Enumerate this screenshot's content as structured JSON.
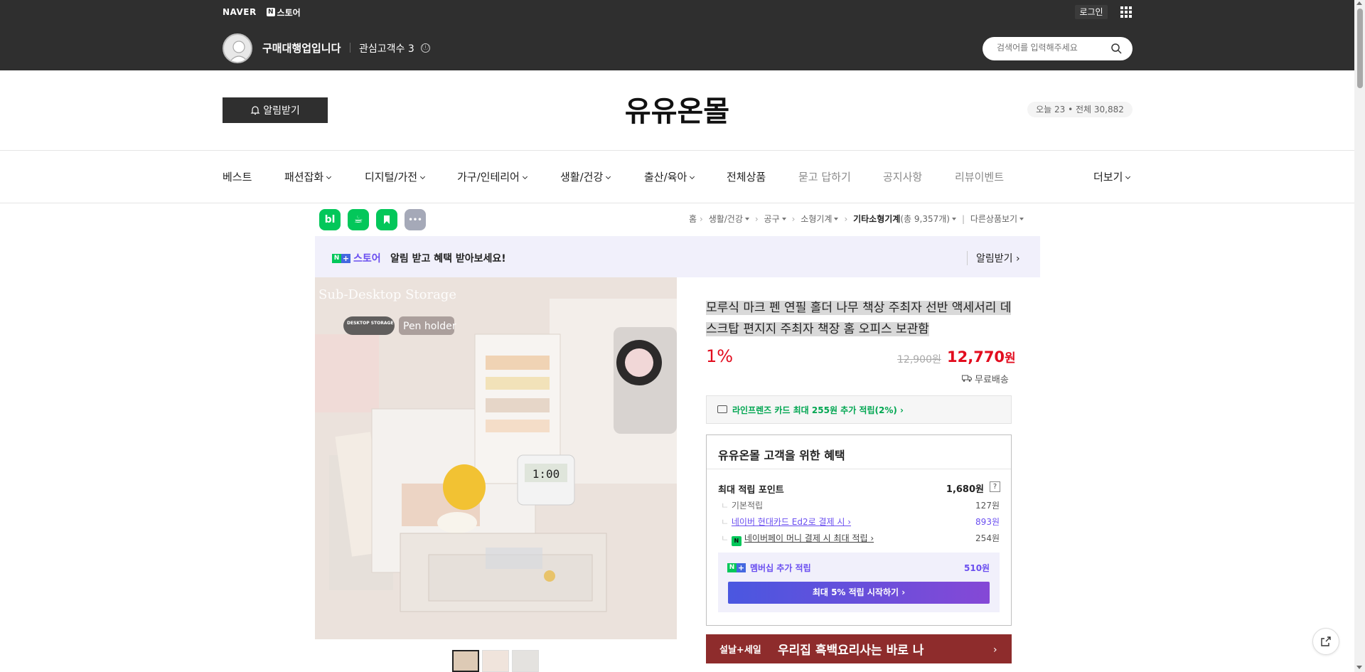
{
  "topbar": {
    "naver_logo": "NAVER",
    "store_badge": {
      "n": "N",
      "plus": "+",
      "label": "스토어"
    },
    "login_label": "로그인",
    "seller_name": "구매대행업입니다",
    "interest_label": "관심고객수 3",
    "info_icon": "ⓘ",
    "search_placeholder": "검색어를 입력해주세요"
  },
  "header": {
    "alarm_label": "알림받기",
    "store_title": "유유온몰",
    "visits": "오늘 23 • 전체 30,882"
  },
  "nav": {
    "items": [
      "베스트",
      "패션잡화",
      "디지털/가전",
      "가구/인테리어",
      "생활/건강",
      "출산/육아",
      "전체상품",
      "묻고 답하기",
      "공지사항",
      "리뷰이벤트",
      "더보기"
    ]
  },
  "icons": {
    "blog": "bl",
    "cafe": "☕",
    "bookmark": "⌂",
    "more": "•••"
  },
  "breadcrumb": {
    "items": [
      "홈",
      "생활/건강",
      "공구",
      "소형기계",
      "기타소형기계",
      "(총 9,357개)",
      "다른상품보기"
    ]
  },
  "promo": {
    "store_label": "스토어",
    "text": "알림 받고 혜택 받아보세요!",
    "link": "알림받기 ›"
  },
  "product": {
    "image_texts": {
      "sub_desktop": "Sub-Desktop Storage",
      "desktop_storage": "DESKTOP STORAGE",
      "pen_holder": "Pen holder"
    },
    "title": "모루식 마크 펜 연필 홀더 나무 책상 주최자 선반 액세서리 데스크탑 편지지 주최자 책장 홈 오피스 보관함",
    "discount": "1%",
    "original_price": "12,900원",
    "price": "12,770",
    "price_unit": "원",
    "shipping": "무료배송"
  },
  "card_offer": "라인프렌즈 카드 최대 255원 추가 적립(2%) ›",
  "benefits": {
    "title": "유유온몰 고객을 위한 혜택",
    "max_points_label": "최대 적립 포인트",
    "max_points_val": "1,680원",
    "q_icon": "?",
    "rows": [
      {
        "label": "기본적립",
        "val": "127원"
      },
      {
        "label": "네이버 현대카드 Ed2로 결제 시 ›",
        "val": "893원"
      },
      {
        "label": "네이버페이 머니 결제 시 최대 적립 ›",
        "val": "254원"
      }
    ],
    "npay_badge": "N",
    "membership_label": "멤버십 추가 적립",
    "membership_val": "510원",
    "membership_btn": "최대 5% 적립 시작하기 ›"
  },
  "banner": {
    "small": "설날+세일",
    "big": "우리집 흑백요리사는 바로 나",
    "chevron": "›"
  },
  "colors": {
    "topbar": "#2f2f2f",
    "price_red": "#e20c1e",
    "naver_green": "#03c75a",
    "purple": "#6a4ef0"
  }
}
